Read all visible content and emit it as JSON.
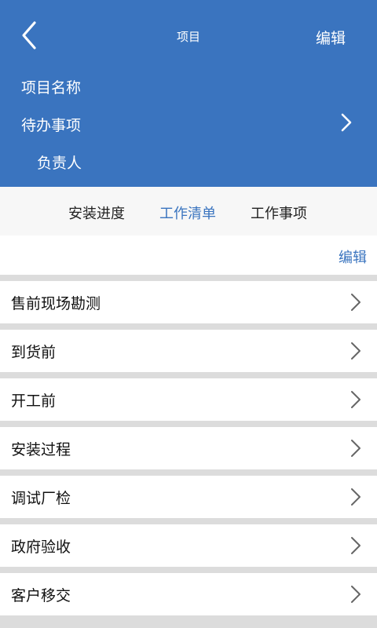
{
  "header": {
    "title": "项目",
    "edit_label": "编辑",
    "project_name_label": "项目名称",
    "todo_label": "待办事项",
    "owner_label": "负责人"
  },
  "tabs": [
    {
      "label": "安装进度",
      "active": false
    },
    {
      "label": "工作清单",
      "active": true
    },
    {
      "label": "工作事项",
      "active": false
    }
  ],
  "list_edit_label": "编辑",
  "items": [
    {
      "label": "售前现场勘测"
    },
    {
      "label": "到货前"
    },
    {
      "label": "开工前"
    },
    {
      "label": "安装过程"
    },
    {
      "label": "调试厂检"
    },
    {
      "label": "政府验收"
    },
    {
      "label": "客户移交"
    }
  ],
  "colors": {
    "header_bg": "#3a74bf",
    "accent": "#3a74bf",
    "separator": "#dcdcdc"
  }
}
